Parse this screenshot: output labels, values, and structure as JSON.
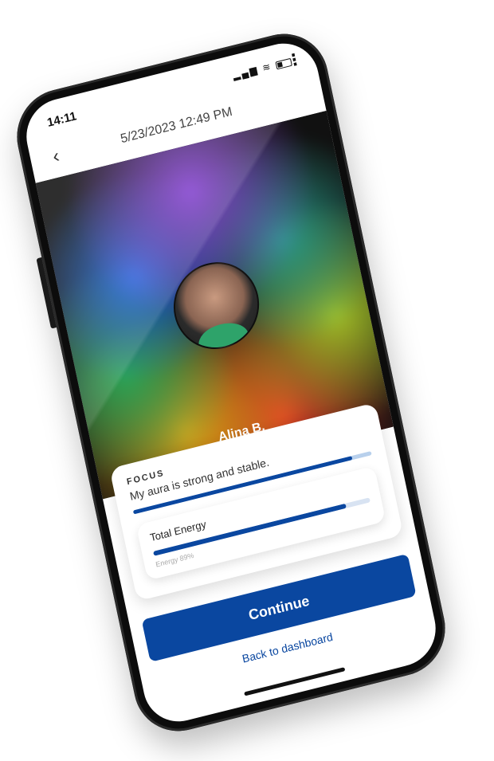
{
  "status_bar": {
    "time": "14:11",
    "signal_icon": "signal-bars-icon",
    "wifi_icon": "wifi-icon",
    "battery_icon": "battery-icon"
  },
  "header": {
    "back_icon": "chevron-left-icon",
    "title": "5/23/2023 12:49 PM",
    "more_icon": "vertical-dots-icon"
  },
  "aura": {
    "name": "Alina B."
  },
  "focus": {
    "label": "FOCUS",
    "description": "My aura is strong and stable.",
    "level_percent": 92
  },
  "energy": {
    "title": "Total Energy",
    "percent": 89,
    "caption": "Energy 89%"
  },
  "actions": {
    "continue_label": "Continue",
    "dashboard_label": "Back to dashboard"
  },
  "colors": {
    "primary": "#0a47a0",
    "bar_track": "#b8d0ec"
  }
}
